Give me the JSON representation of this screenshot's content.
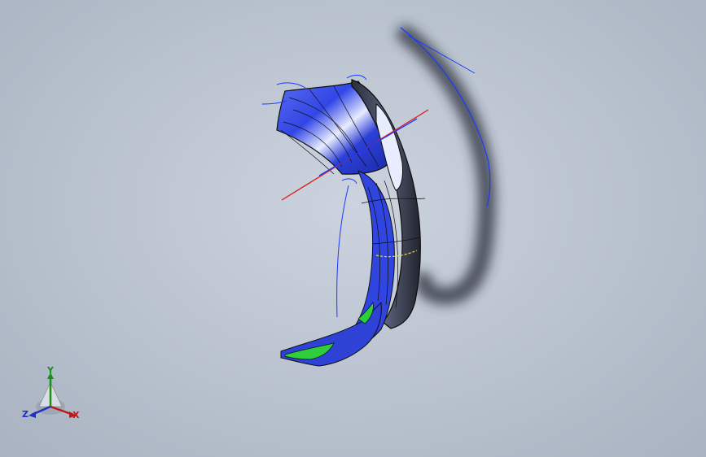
{
  "viewport": {
    "background_top": "#ccd3de",
    "background_bottom": "#a9b3c1"
  },
  "model": {
    "part_color": "#3a4fe0",
    "edge_color": "#1a1a1a",
    "sketch_color": "#1a3bff",
    "accent_green": "#2ecf3a"
  },
  "triad": {
    "y_label": "Y",
    "z_label": "Z",
    "x_label": "X",
    "x_color": "#c01818",
    "y_color": "#1a8f1a",
    "z_color": "#2030c0"
  }
}
